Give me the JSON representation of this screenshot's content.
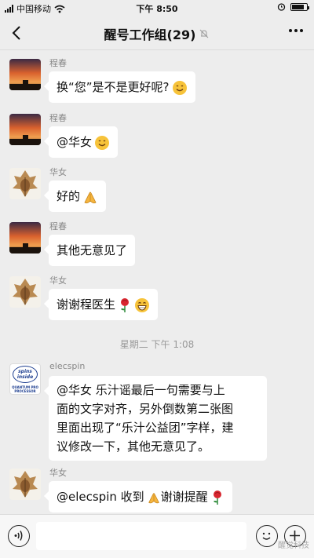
{
  "status_bar": {
    "carrier": "中国移动",
    "time": "下午 8:50"
  },
  "header": {
    "title": "醒号工作组(29)"
  },
  "messages": [
    {
      "sender": "程春",
      "text": "换“您”是不是更好呢?",
      "emoji": "smile"
    },
    {
      "sender": "程春",
      "text": "@华女",
      "emoji": "smile"
    },
    {
      "sender": "华女",
      "text": "好的",
      "emoji": "pray"
    },
    {
      "sender": "程春",
      "text": "其他无意见了"
    },
    {
      "sender": "华女",
      "text": "谢谢程医生",
      "emoji": "rose+grin"
    },
    {
      "sender": "elecspin",
      "lines": [
        "@华女 乐汁谣最后一句需要与上",
        "面的文字对齐，另外倒数第二张图",
        "里面出现了“乐汁公益团”字样，建",
        "议修改一下，其他无意见了。"
      ]
    },
    {
      "sender": "华女",
      "text_a": "@elecspin 收到",
      "text_b": "谢谢提醒",
      "emoji": "pray+rose"
    }
  ],
  "timestamp": "星期二 下午 1:08",
  "elecspin_avatar": {
    "line1": "spins",
    "line2": "inside",
    "line3": "QUANTUM PRO",
    "line4": "PROCESSOR"
  },
  "watermark": "醒觉科技",
  "colors": {
    "background": "#ededed",
    "bubble": "#ffffff",
    "sender": "#888888"
  }
}
